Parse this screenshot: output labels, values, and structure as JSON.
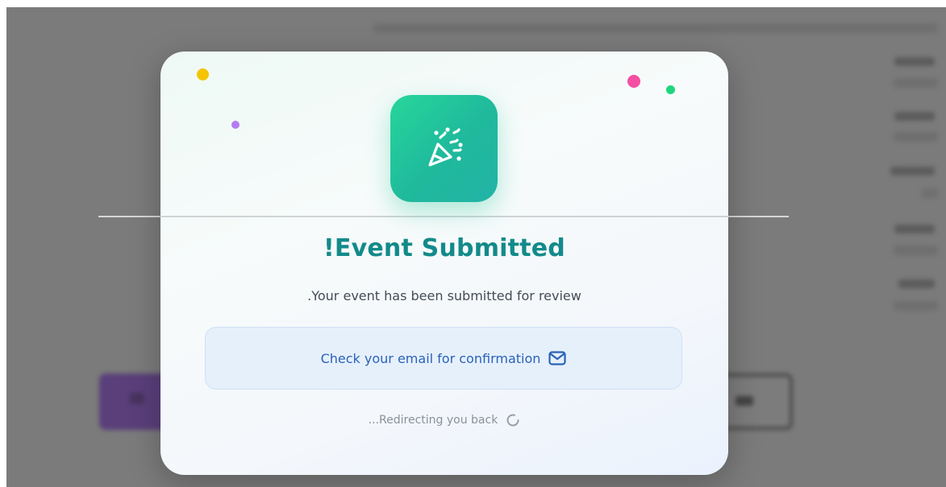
{
  "modal": {
    "title": "!Event Submitted",
    "subtitle": ".Your event has been submitted for review",
    "email_notice": "Check your email for confirmation",
    "redirect_text": "...Redirecting you back",
    "icons": {
      "hero": "party-popper-icon",
      "email": "mail-icon",
      "redirect": "loading-spinner-icon"
    }
  },
  "colors": {
    "title": "#138a8a",
    "email_text": "#2a62b8",
    "tile_start": "#27d69b",
    "tile_end": "#23b3a6",
    "confetti_yellow": "#f5c400",
    "confetti_pink": "#f34fa3",
    "confetti_green": "#1fd67f",
    "confetti_purple": "#b57cf2"
  }
}
